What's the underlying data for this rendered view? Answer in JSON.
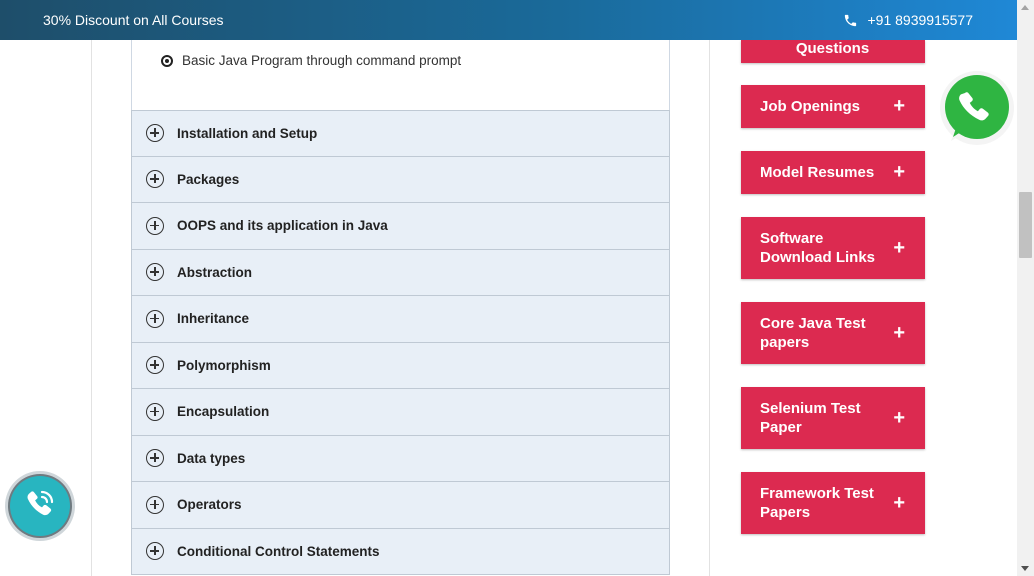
{
  "topbar": {
    "promo": "30% Discount on All Courses",
    "phone": "+91 8939915577"
  },
  "prev_section": {
    "sub_item": "Basic Java Program through command prompt"
  },
  "accordion": {
    "items": [
      {
        "label": "Installation and Setup"
      },
      {
        "label": "Packages"
      },
      {
        "label": "OOPS and its application in Java"
      },
      {
        "label": "Abstraction"
      },
      {
        "label": "Inheritance"
      },
      {
        "label": "Polymorphism"
      },
      {
        "label": "Encapsulation"
      },
      {
        "label": "Data types"
      },
      {
        "label": "Operators"
      },
      {
        "label": "Conditional Control Statements"
      }
    ]
  },
  "sidebar": {
    "partial_label": "Questions",
    "buttons": [
      {
        "label": "Job Openings",
        "icon": "+"
      },
      {
        "label": "Model Resumes",
        "icon": "+"
      },
      {
        "label": "Software Download Links",
        "icon": "+"
      },
      {
        "label": "Core Java Test papers",
        "icon": "+"
      },
      {
        "label": "Selenium Test Paper",
        "icon": "+"
      },
      {
        "label": "Framework Test Papers",
        "icon": "+"
      }
    ]
  },
  "colors": {
    "accent_red": "#dc2a50",
    "topbar_start": "#1e4e6a",
    "topbar_end": "#1f88d6",
    "accordion_bg": "#e8eff7",
    "whatsapp_green": "#2fb542",
    "call_teal": "#28b5c0"
  },
  "icons": {
    "phone": "phone-icon",
    "whatsapp": "whatsapp-icon",
    "call": "call-icon",
    "accordion_toggle": "plus-circle-icon",
    "radio": "radio-bullet-icon"
  }
}
